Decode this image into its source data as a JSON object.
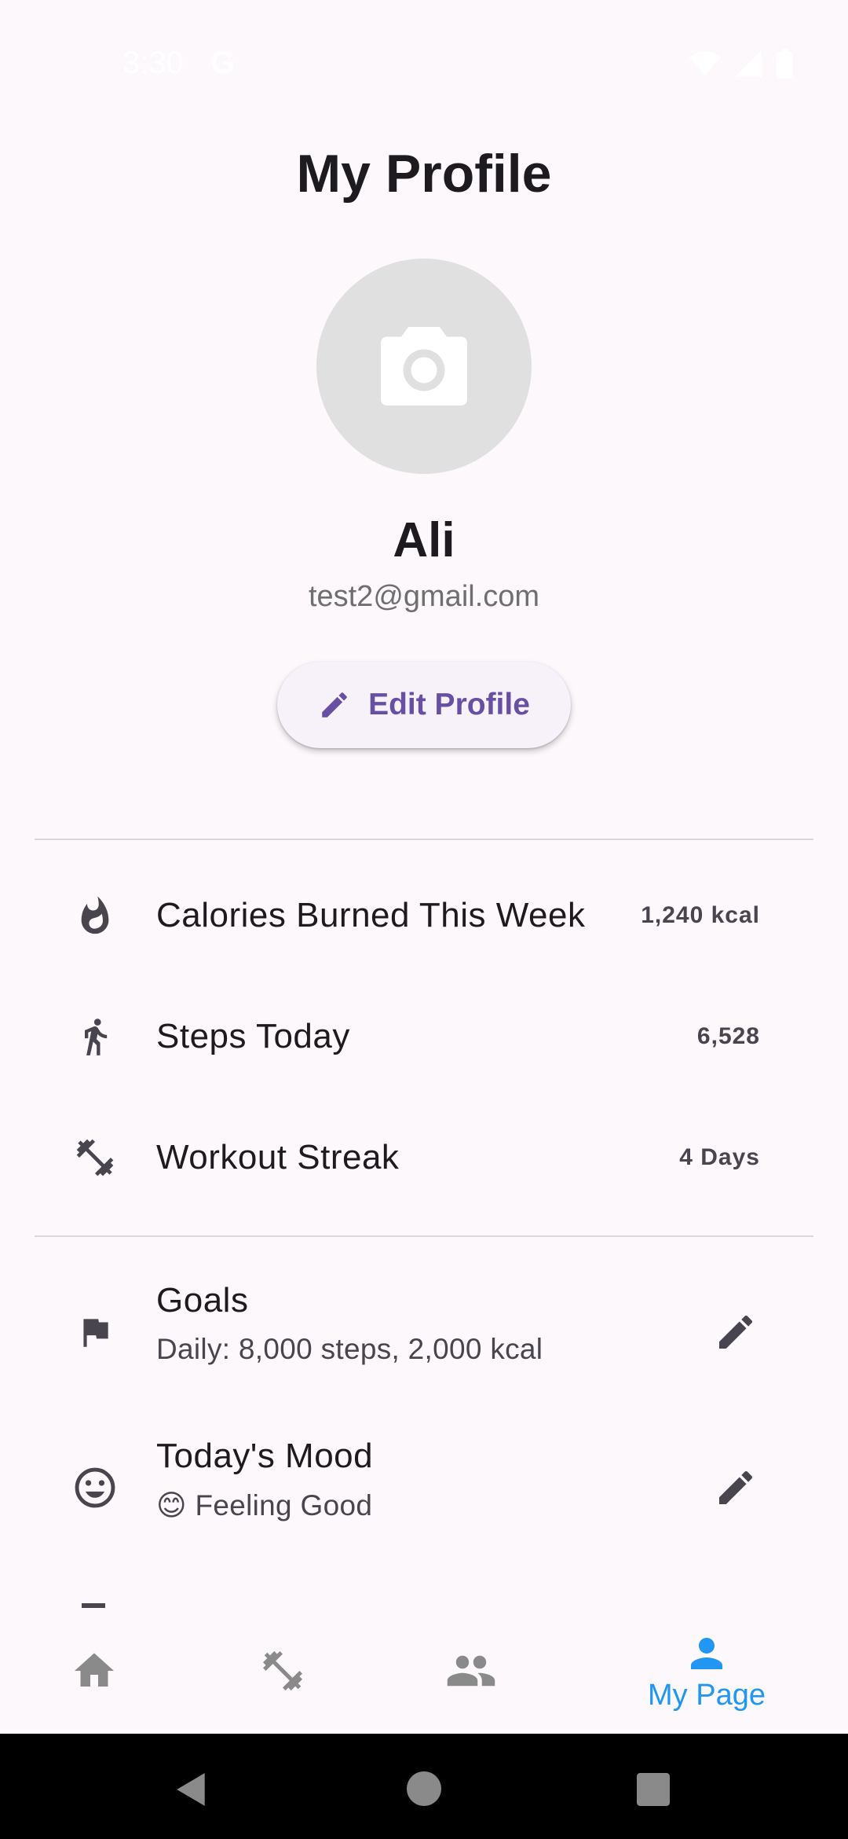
{
  "status_bar": {
    "time": "3:30",
    "indicator": "G"
  },
  "header": {
    "title": "My Profile"
  },
  "profile": {
    "name": "Ali",
    "email": "test2@gmail.com",
    "avatar_icon": "camera-icon"
  },
  "edit_profile": {
    "label": "Edit Profile",
    "icon": "pencil-icon"
  },
  "stats": [
    {
      "icon": "flame-icon",
      "label": "Calories Burned This Week",
      "value": "1,240 kcal"
    },
    {
      "icon": "walking-icon",
      "label": "Steps Today",
      "value": "6,528"
    },
    {
      "icon": "dumbbell-icon",
      "label": "Workout Streak",
      "value": "4 Days"
    }
  ],
  "settings": [
    {
      "icon": "flag-icon",
      "title": "Goals",
      "subtitle": "Daily: 8,000 steps, 2,000 kcal"
    },
    {
      "icon": "smiley-icon",
      "title": "Today's Mood",
      "subtitle": "😊 Feeling Good"
    }
  ],
  "bottom_nav": [
    {
      "icon": "home-icon",
      "label": "",
      "active": false
    },
    {
      "icon": "dumbbell-icon",
      "label": "",
      "active": false
    },
    {
      "icon": "people-icon",
      "label": "",
      "active": false
    },
    {
      "icon": "person-icon",
      "label": "My Page",
      "active": true
    }
  ],
  "colors": {
    "background": "#fdf8fc",
    "accent_purple": "#6750a4",
    "nav_active": "#2196f3",
    "nav_inactive": "#8a8a8a",
    "avatar_bg": "#e0e0e0"
  }
}
